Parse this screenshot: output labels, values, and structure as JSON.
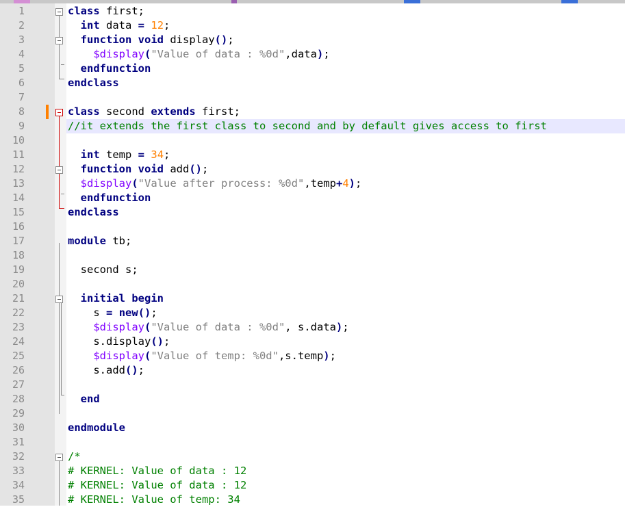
{
  "editor": {
    "lines": [
      {
        "n": "1",
        "tokens": [
          {
            "t": "class",
            "c": "kw"
          },
          {
            "t": " first;",
            "c": ""
          }
        ]
      },
      {
        "n": "2",
        "tokens": [
          {
            "t": "  ",
            "c": ""
          },
          {
            "t": "int",
            "c": "kw"
          },
          {
            "t": " data ",
            "c": ""
          },
          {
            "t": "=",
            "c": "op"
          },
          {
            "t": " ",
            "c": ""
          },
          {
            "t": "12",
            "c": "num"
          },
          {
            "t": ";",
            "c": ""
          }
        ]
      },
      {
        "n": "3",
        "tokens": [
          {
            "t": "  ",
            "c": ""
          },
          {
            "t": "function",
            "c": "kw"
          },
          {
            "t": " ",
            "c": ""
          },
          {
            "t": "void",
            "c": "kw"
          },
          {
            "t": " display",
            "c": ""
          },
          {
            "t": "()",
            "c": "op"
          },
          {
            "t": ";",
            "c": ""
          }
        ]
      },
      {
        "n": "4",
        "tokens": [
          {
            "t": "    ",
            "c": ""
          },
          {
            "t": "$display",
            "c": "sys"
          },
          {
            "t": "(",
            "c": "op"
          },
          {
            "t": "\"Value of data : %0d\"",
            "c": "str"
          },
          {
            "t": ",data",
            "c": ""
          },
          {
            "t": ")",
            "c": "op"
          },
          {
            "t": ";",
            "c": ""
          }
        ]
      },
      {
        "n": "5",
        "tokens": [
          {
            "t": "  ",
            "c": ""
          },
          {
            "t": "endfunction",
            "c": "kw"
          }
        ]
      },
      {
        "n": "6",
        "tokens": [
          {
            "t": "endclass",
            "c": "kw"
          }
        ]
      },
      {
        "n": "7",
        "tokens": []
      },
      {
        "n": "8",
        "tokens": [
          {
            "t": "class",
            "c": "kw"
          },
          {
            "t": " second ",
            "c": ""
          },
          {
            "t": "extends",
            "c": "kw"
          },
          {
            "t": " first;",
            "c": ""
          }
        ]
      },
      {
        "n": "9",
        "tokens": [
          {
            "t": "//it extends the first class to second and by default gives access to first",
            "c": "cmt"
          }
        ]
      },
      {
        "n": "10",
        "tokens": []
      },
      {
        "n": "11",
        "tokens": [
          {
            "t": "  ",
            "c": ""
          },
          {
            "t": "int",
            "c": "kw"
          },
          {
            "t": " temp ",
            "c": ""
          },
          {
            "t": "=",
            "c": "op"
          },
          {
            "t": " ",
            "c": ""
          },
          {
            "t": "34",
            "c": "num"
          },
          {
            "t": ";",
            "c": ""
          }
        ]
      },
      {
        "n": "12",
        "tokens": [
          {
            "t": "  ",
            "c": ""
          },
          {
            "t": "function",
            "c": "kw"
          },
          {
            "t": " ",
            "c": ""
          },
          {
            "t": "void",
            "c": "kw"
          },
          {
            "t": " add",
            "c": ""
          },
          {
            "t": "()",
            "c": "op"
          },
          {
            "t": ";",
            "c": ""
          }
        ]
      },
      {
        "n": "13",
        "tokens": [
          {
            "t": "  ",
            "c": ""
          },
          {
            "t": "$display",
            "c": "sys"
          },
          {
            "t": "(",
            "c": "op"
          },
          {
            "t": "\"Value after process: %0d\"",
            "c": "str"
          },
          {
            "t": ",temp",
            "c": ""
          },
          {
            "t": "+",
            "c": "op"
          },
          {
            "t": "4",
            "c": "num"
          },
          {
            "t": ")",
            "c": "op"
          },
          {
            "t": ";",
            "c": ""
          }
        ]
      },
      {
        "n": "14",
        "tokens": [
          {
            "t": "  ",
            "c": ""
          },
          {
            "t": "endfunction",
            "c": "kw"
          }
        ]
      },
      {
        "n": "15",
        "tokens": [
          {
            "t": "endclass",
            "c": "kw"
          }
        ]
      },
      {
        "n": "16",
        "tokens": []
      },
      {
        "n": "17",
        "tokens": [
          {
            "t": "module",
            "c": "kw"
          },
          {
            "t": " tb;",
            "c": ""
          }
        ]
      },
      {
        "n": "18",
        "tokens": []
      },
      {
        "n": "19",
        "tokens": [
          {
            "t": "  second s;",
            "c": ""
          }
        ]
      },
      {
        "n": "20",
        "tokens": []
      },
      {
        "n": "21",
        "tokens": [
          {
            "t": "  ",
            "c": ""
          },
          {
            "t": "initial",
            "c": "kw"
          },
          {
            "t": " ",
            "c": ""
          },
          {
            "t": "begin",
            "c": "kw"
          }
        ]
      },
      {
        "n": "22",
        "tokens": [
          {
            "t": "    s ",
            "c": ""
          },
          {
            "t": "=",
            "c": "op"
          },
          {
            "t": " ",
            "c": ""
          },
          {
            "t": "new",
            "c": "kw"
          },
          {
            "t": "()",
            "c": "op"
          },
          {
            "t": ";",
            "c": ""
          }
        ]
      },
      {
        "n": "23",
        "tokens": [
          {
            "t": "    ",
            "c": ""
          },
          {
            "t": "$display",
            "c": "sys"
          },
          {
            "t": "(",
            "c": "op"
          },
          {
            "t": "\"Value of data : %0d\"",
            "c": "str"
          },
          {
            "t": ", s.data",
            "c": ""
          },
          {
            "t": ")",
            "c": "op"
          },
          {
            "t": ";",
            "c": ""
          }
        ]
      },
      {
        "n": "24",
        "tokens": [
          {
            "t": "    s.display",
            "c": ""
          },
          {
            "t": "()",
            "c": "op"
          },
          {
            "t": ";",
            "c": ""
          }
        ]
      },
      {
        "n": "25",
        "tokens": [
          {
            "t": "    ",
            "c": ""
          },
          {
            "t": "$display",
            "c": "sys"
          },
          {
            "t": "(",
            "c": "op"
          },
          {
            "t": "\"Value of temp: %0d\"",
            "c": "str"
          },
          {
            "t": ",s.temp",
            "c": ""
          },
          {
            "t": ")",
            "c": "op"
          },
          {
            "t": ";",
            "c": ""
          }
        ]
      },
      {
        "n": "26",
        "tokens": [
          {
            "t": "    s.add",
            "c": ""
          },
          {
            "t": "()",
            "c": "op"
          },
          {
            "t": ";",
            "c": ""
          }
        ]
      },
      {
        "n": "27",
        "tokens": []
      },
      {
        "n": "28",
        "tokens": [
          {
            "t": "  ",
            "c": ""
          },
          {
            "t": "end",
            "c": "kw"
          }
        ]
      },
      {
        "n": "29",
        "tokens": []
      },
      {
        "n": "30",
        "tokens": [
          {
            "t": "endmodule",
            "c": "kw"
          }
        ]
      },
      {
        "n": "31",
        "tokens": []
      },
      {
        "n": "32",
        "tokens": [
          {
            "t": "/*",
            "c": "cmt"
          }
        ]
      },
      {
        "n": "33",
        "tokens": [
          {
            "t": "# KERNEL: Value of data : 12",
            "c": "cmt"
          }
        ]
      },
      {
        "n": "34",
        "tokens": [
          {
            "t": "# KERNEL: Value of data : 12",
            "c": "cmt"
          }
        ]
      },
      {
        "n": "35",
        "tokens": [
          {
            "t": "# KERNEL: Value of temp: 34",
            "c": "cmt"
          }
        ]
      }
    ],
    "highlighted_line": 9,
    "marked_line": 8,
    "colors": {
      "keyword": "#000080",
      "number": "#ff8000",
      "system_task": "#8000ff",
      "string": "#808080",
      "comment": "#008000",
      "highlight": "#e8e8ff",
      "change_marker": "#ff8000",
      "fold_active": "#cc0000"
    }
  }
}
